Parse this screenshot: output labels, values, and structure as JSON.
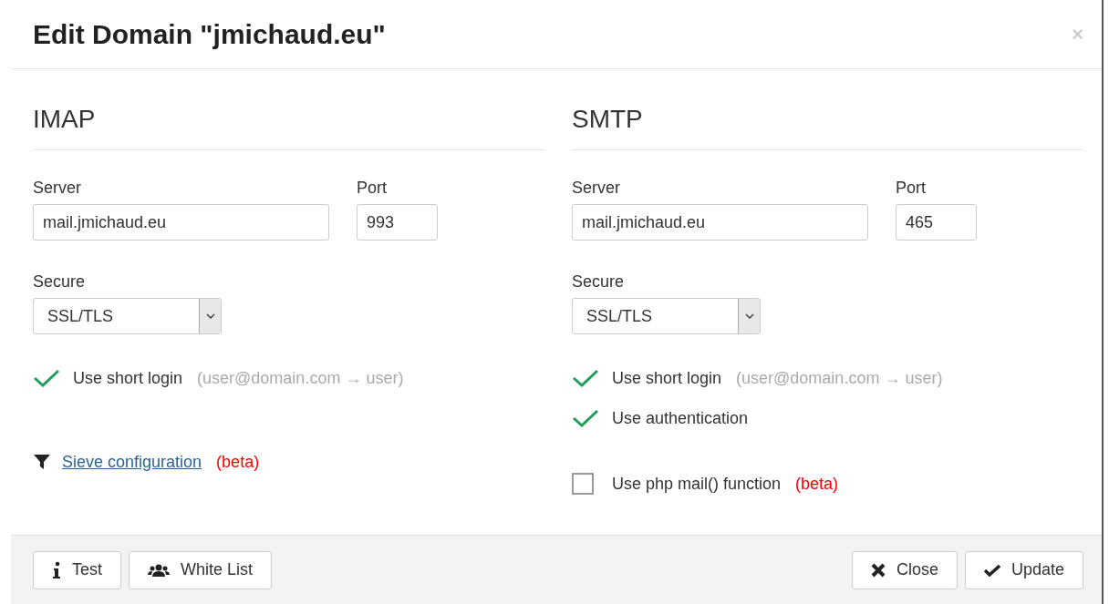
{
  "dialog": {
    "title": "Edit Domain \"jmichaud.eu\"",
    "close": "×"
  },
  "sections": [
    {
      "heading": "IMAP",
      "server_label": "Server",
      "server_value": "mail.jmichaud.eu",
      "port_label": "Port",
      "port_value": "993",
      "secure_label": "Secure",
      "secure_value": "SSL/TLS",
      "options": [
        {
          "label": "Use short login",
          "hint": "(user@domain.com → user)",
          "checked": true
        }
      ],
      "extra": {
        "kind": "link",
        "label": "Sieve configuration",
        "badge": "(beta)"
      }
    },
    {
      "heading": "SMTP",
      "server_label": "Server",
      "server_value": "mail.jmichaud.eu",
      "port_label": "Port",
      "port_value": "465",
      "secure_label": "Secure",
      "secure_value": "SSL/TLS",
      "options": [
        {
          "label": "Use short login",
          "hint": "(user@domain.com → user)",
          "checked": true
        },
        {
          "label": "Use authentication",
          "checked": true
        }
      ],
      "extra": {
        "kind": "checkbox",
        "label": "Use php mail() function",
        "badge": "(beta)",
        "checked": false
      }
    }
  ],
  "footer": {
    "left": [
      {
        "kind": "info",
        "label": "Test"
      },
      {
        "kind": "users",
        "label": "White List"
      }
    ],
    "right": [
      {
        "kind": "close",
        "label": "Close"
      },
      {
        "kind": "check",
        "label": "Update"
      }
    ]
  }
}
